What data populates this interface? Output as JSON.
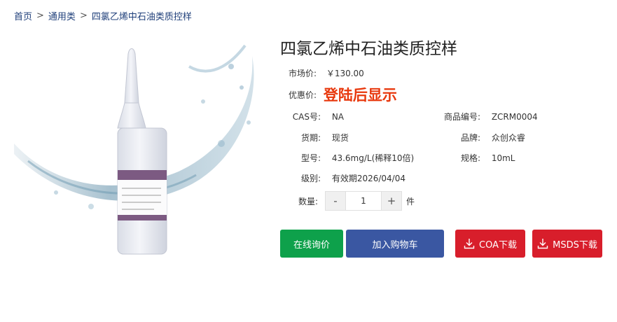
{
  "breadcrumb": {
    "items": [
      "首页",
      "通用类",
      "四氯乙烯中石油类质控样"
    ],
    "separator": ">"
  },
  "product": {
    "title": "四氯乙烯中石油类质控样",
    "market_price_label": "市场价:",
    "market_price": "￥130.00",
    "promo_price_label": "优惠价:",
    "promo_price": "登陆后显示",
    "cas_label": "CAS号:",
    "cas": "NA",
    "code_label": "商品编号:",
    "code": "ZCRM0004",
    "stock_label": "货期:",
    "stock": "现货",
    "brand_label": "品牌:",
    "brand": "众创众睿",
    "model_label": "型号:",
    "model": "43.6mg/L(稀释10倍)",
    "spec_label": "规格:",
    "spec": "10mL",
    "grade_label": "级别:",
    "grade": "有效期2026/04/04"
  },
  "quantity": {
    "label": "数量:",
    "minus": "-",
    "value": "1",
    "plus": "+",
    "unit": "件"
  },
  "actions": {
    "inquiry": "在线询价",
    "cart": "加入购物车",
    "coa": "COA下载",
    "msds": "MSDS下载"
  },
  "colors": {
    "breadcrumb": "#1f3f7a",
    "promo": "#e8380d",
    "inquiry": "#0ea14b",
    "cart": "#3a57a2",
    "download": "#d81e2b"
  }
}
